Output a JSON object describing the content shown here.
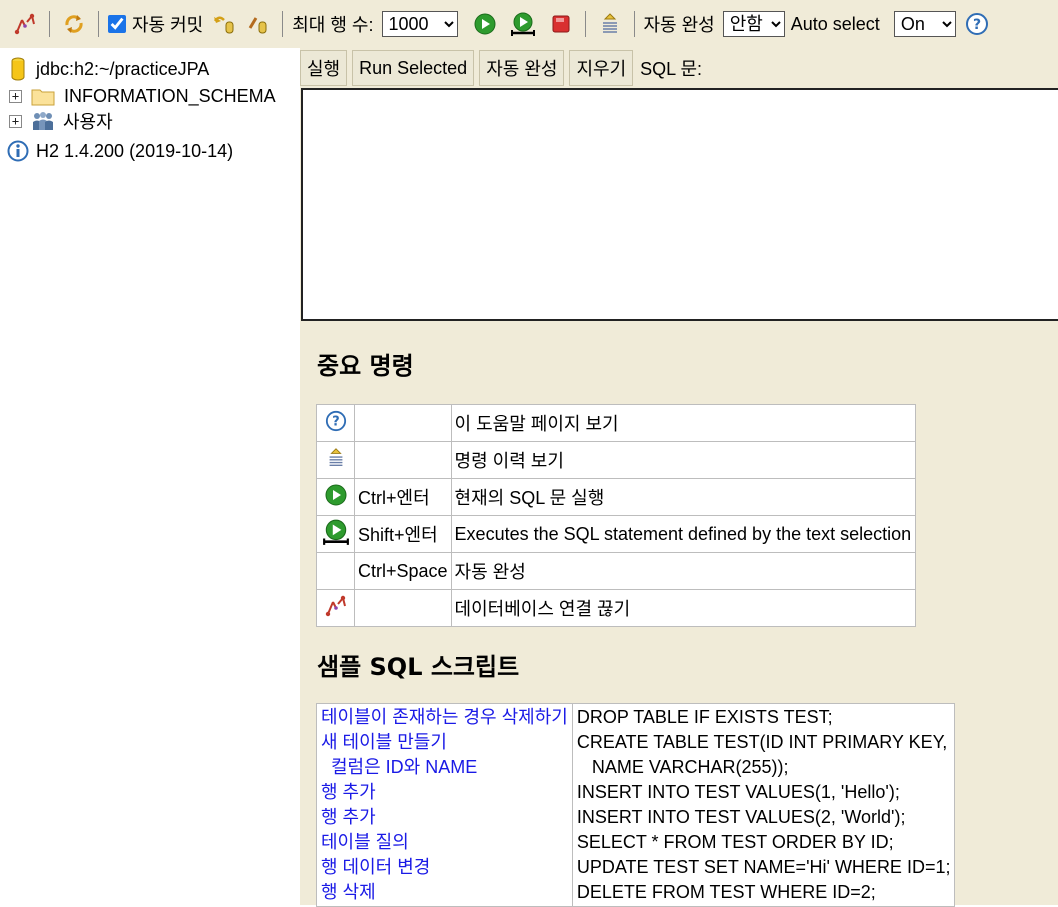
{
  "toolbar": {
    "auto_commit_label": "자동 커밋",
    "auto_commit_checked": true,
    "max_rows_label": "최대 행 수:",
    "max_rows_value": "1000",
    "auto_complete_label": "자동 완성",
    "auto_complete_value": "안함",
    "auto_select_label": "Auto select",
    "auto_select_value": "On"
  },
  "tree": {
    "connection": "jdbc:h2:~/practiceJPA",
    "schema": "INFORMATION_SCHEMA",
    "users": "사용자",
    "version": "H2 1.4.200 (2019-10-14)"
  },
  "query": {
    "run_button": "실행",
    "run_selected_button": "Run Selected",
    "auto_complete_button": "자동 완성",
    "clear_button": "지우기",
    "sql_label": "SQL 문:"
  },
  "help": {
    "title": "중요 명령",
    "rows": [
      {
        "icon": "help-icon",
        "key": "",
        "desc": "이 도움말 페이지 보기"
      },
      {
        "icon": "history-icon",
        "key": "",
        "desc": "명령 이력 보기"
      },
      {
        "icon": "run-icon",
        "key": "Ctrl+엔터",
        "desc": "현재의 SQL 문 실행"
      },
      {
        "icon": "run-selected-icon",
        "key": "Shift+엔터",
        "desc": "Executes the SQL statement defined by the text selection"
      },
      {
        "icon": "",
        "key": "Ctrl+Space",
        "desc": "자동 완성"
      },
      {
        "icon": "disconnect-icon",
        "key": "",
        "desc": "데이터베이스 연결 끊기"
      }
    ]
  },
  "samples": {
    "title": "샘플 SQL 스크립트",
    "links": [
      "테이블이 존재하는 경우 삭제하기",
      "새 테이블 만들기",
      "  컬럼은 ID와 NAME",
      "행 추가",
      "행 추가",
      "테이블 질의",
      "행 데이터 변경",
      "행 삭제"
    ],
    "sql": [
      "DROP TABLE IF EXISTS TEST;",
      "CREATE TABLE TEST(ID INT PRIMARY KEY,",
      "   NAME VARCHAR(255));",
      "INSERT INTO TEST VALUES(1, 'Hello');",
      "INSERT INTO TEST VALUES(2, 'World');",
      "SELECT * FROM TEST ORDER BY ID;",
      "UPDATE TEST SET NAME='Hi' WHERE ID=1;",
      "DELETE FROM TEST WHERE ID=2;"
    ]
  },
  "colors": {
    "panel_bg": "#f0ebd8",
    "link": "#1a1ae6",
    "run_green": "#2e9b2e",
    "stop_red": "#d93030"
  }
}
